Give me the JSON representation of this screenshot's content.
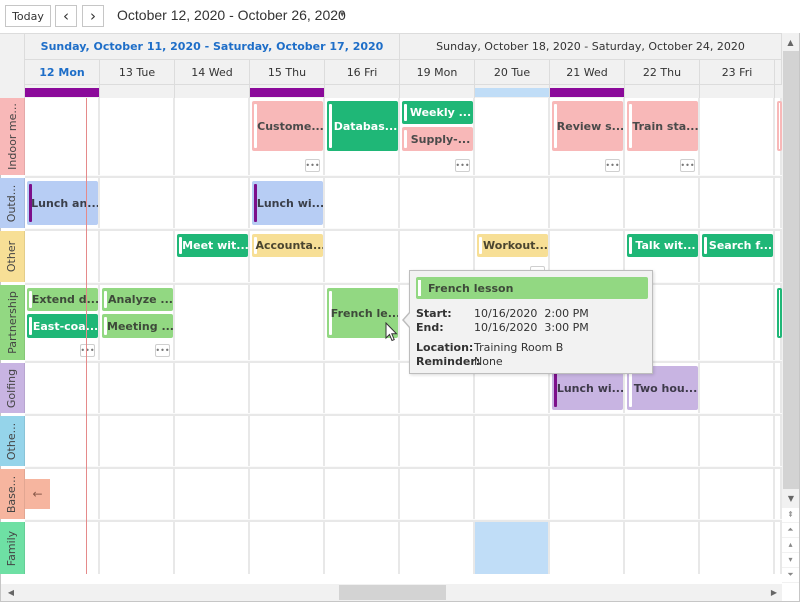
{
  "toolbar": {
    "today_label": "Today",
    "prev_icon": "‹",
    "next_icon": "›",
    "date_range": "October 12, 2020 - October 26, 2020",
    "dropdown_icon": "▾"
  },
  "weeks": [
    {
      "label": "Sunday, October 11, 2020 - Saturday, October 17, 2020",
      "current": true
    },
    {
      "label": "Sunday, October 18, 2020 - Saturday, October 24, 2020",
      "current": false
    }
  ],
  "days": [
    {
      "label": "12 Mon",
      "today": true
    },
    {
      "label": "13 Tue",
      "today": false
    },
    {
      "label": "14 Wed",
      "today": false
    },
    {
      "label": "15 Thu",
      "today": false
    },
    {
      "label": "16 Fri",
      "today": false
    },
    {
      "label": "19 Mon",
      "today": false
    },
    {
      "label": "20 Tue",
      "today": false
    },
    {
      "label": "21 Wed",
      "today": false
    },
    {
      "label": "22 Thu",
      "today": false
    },
    {
      "label": "23 Fri",
      "today": false
    }
  ],
  "allday_markers": [
    {
      "day": 0,
      "color": "#8b0a9a"
    },
    {
      "day": 3,
      "color": "#8b0a9a"
    },
    {
      "day": 6,
      "color": "#c0ddf7"
    },
    {
      "day": 7,
      "color": "#8b0a9a"
    }
  ],
  "resources": [
    {
      "label": "Indoor me...",
      "color": "#f8b8b8"
    },
    {
      "label": "Outd...",
      "color": "#b7cdf4"
    },
    {
      "label": "Other",
      "color": "#f7df96"
    },
    {
      "label": "Partnership",
      "color": "#92d882"
    },
    {
      "label": "Golfing",
      "color": "#c8b4e2"
    },
    {
      "label": "Othe...",
      "color": "#95d4ea"
    },
    {
      "label": "Base...",
      "color": "#f6b59f"
    },
    {
      "label": "Family",
      "color": "#6ee0a4"
    }
  ],
  "colors": {
    "pink": "#f8b8b8",
    "green": "#1fb777",
    "lightgreen": "#92d882",
    "blue": "#b7cdf4",
    "yellow": "#f7df96",
    "purple": "#c8b4e2",
    "purple_stripe": "#7c0f8a",
    "highlight": "#c0ddf7"
  },
  "events": [
    {
      "res": 0,
      "day": 3,
      "slot": "full",
      "title": "Custome...",
      "color": "pink",
      "more": true
    },
    {
      "res": 0,
      "day": 4,
      "slot": "full",
      "title": "Databas...",
      "color": "green",
      "more": false
    },
    {
      "res": 0,
      "day": 5,
      "slot": "top",
      "title": "Weekly ...",
      "color": "green",
      "more": true
    },
    {
      "res": 0,
      "day": 5,
      "slot": "bottom",
      "title": "Supply-...",
      "color": "pink",
      "more": false
    },
    {
      "res": 0,
      "day": 7,
      "slot": "full",
      "title": "Review s...",
      "color": "pink",
      "more": true
    },
    {
      "res": 0,
      "day": 8,
      "slot": "full",
      "title": "Train sta...",
      "color": "pink",
      "more": true
    },
    {
      "res": 1,
      "day": 0,
      "slot": "row",
      "title": "Lunch an...",
      "color": "blue",
      "stripe": "purple",
      "more": false
    },
    {
      "res": 1,
      "day": 3,
      "slot": "row",
      "title": "Lunch wi...",
      "color": "blue",
      "stripe": "purple",
      "more": false
    },
    {
      "res": 2,
      "day": 2,
      "slot": "top",
      "title": "Meet wit...",
      "color": "green",
      "more": false
    },
    {
      "res": 2,
      "day": 3,
      "slot": "top",
      "title": "Accounta...",
      "color": "yellow",
      "more": false
    },
    {
      "res": 2,
      "day": 6,
      "slot": "top",
      "title": "Workout...",
      "color": "yellow",
      "more": true
    },
    {
      "res": 2,
      "day": 8,
      "slot": "top",
      "title": "Talk wit...",
      "color": "green",
      "more": false
    },
    {
      "res": 2,
      "day": 9,
      "slot": "top",
      "title": "Search f...",
      "color": "green",
      "more": false
    },
    {
      "res": 3,
      "day": 0,
      "slot": "top",
      "title": "Extend d...",
      "color": "lightgreen",
      "more": true
    },
    {
      "res": 3,
      "day": 0,
      "slot": "bottom",
      "title": "East-coa...",
      "color": "green",
      "more": false
    },
    {
      "res": 3,
      "day": 1,
      "slot": "top",
      "title": "Analyze ...",
      "color": "lightgreen",
      "more": true
    },
    {
      "res": 3,
      "day": 1,
      "slot": "bottom",
      "title": "Meeting ...",
      "color": "lightgreen",
      "more": false
    },
    {
      "res": 3,
      "day": 4,
      "slot": "full",
      "title": "French le...",
      "color": "lightgreen",
      "more": false
    },
    {
      "res": 4,
      "day": 7,
      "slot": "row",
      "title": "Lunch wi...",
      "color": "purple",
      "stripe": "purple",
      "more": false
    },
    {
      "res": 4,
      "day": 8,
      "slot": "row",
      "title": "Two hou...",
      "color": "purple",
      "more": false
    }
  ],
  "tooltip": {
    "title": "French lesson",
    "start_label": "Start:",
    "start_value": "10/16/2020  2:00 PM",
    "end_label": "End:",
    "end_value": "10/16/2020  3:00 PM",
    "location_label": "Location:",
    "location_value": "Training Room B",
    "reminder_label": "Reminder:",
    "reminder_value": "None"
  },
  "more_glyph": "•••",
  "back_arrow": "←",
  "scroll": {
    "up": "▲",
    "down": "▼",
    "left": "◀",
    "right": "▶",
    "nav_first": "⇞",
    "nav_prev_page": "⏶",
    "nav_prev": "▴",
    "nav_next": "▾",
    "nav_next_page": "⏷",
    "nav_last": "⇟"
  }
}
